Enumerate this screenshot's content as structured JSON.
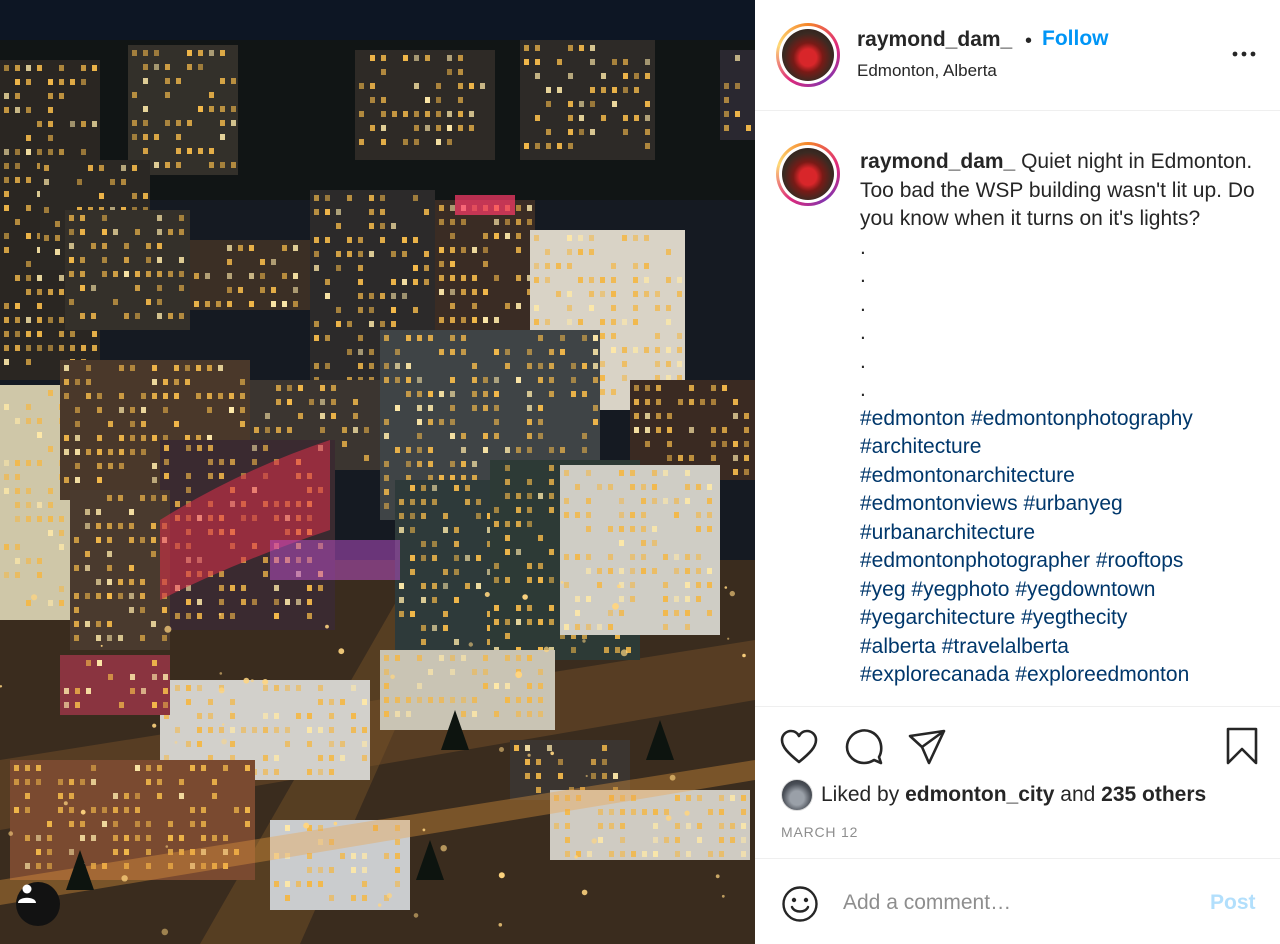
{
  "photo": {
    "alt_icon": "person-icon"
  },
  "header": {
    "username": "raymond_dam_",
    "separator": "•",
    "follow_label": "Follow",
    "location": "Edmonton, Alberta",
    "more_icon": "more-horizontal-icon"
  },
  "caption": {
    "username": "raymond_dam_",
    "text": "Quiet night in Edmonton. Too bad the WSP building wasn't lit up. Do you know when it turns on it's lights?",
    "dots": [
      ".",
      ".",
      ".",
      ".",
      ".",
      "."
    ],
    "hashtag_lines": [
      [
        "#edmonton",
        "#edmontonphotography"
      ],
      [
        "#architecture"
      ],
      [
        "#edmontonarchitecture"
      ],
      [
        "#edmontonviews",
        "#urbanyeg"
      ],
      [
        "#urbanarchitecture"
      ],
      [
        "#edmontonphotographer",
        "#rooftops"
      ],
      [
        "#yeg",
        "#yegphoto",
        "#yegdowntown"
      ],
      [
        "#yegarchitecture",
        "#yegthecity"
      ],
      [
        "#alberta",
        "#travelalberta"
      ],
      [
        "#explorecanada",
        "#exploreedmonton"
      ]
    ]
  },
  "actions": {
    "like_icon": "heart-icon",
    "comment_icon": "comment-icon",
    "share_icon": "share-icon",
    "save_icon": "bookmark-icon"
  },
  "likes": {
    "prefix": "Liked by",
    "user": "edmonton_city",
    "middle": "and",
    "others": "235 others"
  },
  "date": "MARCH 12",
  "comment": {
    "emoji_icon": "smiley-icon",
    "placeholder": "Add a comment…",
    "post_label": "Post"
  }
}
